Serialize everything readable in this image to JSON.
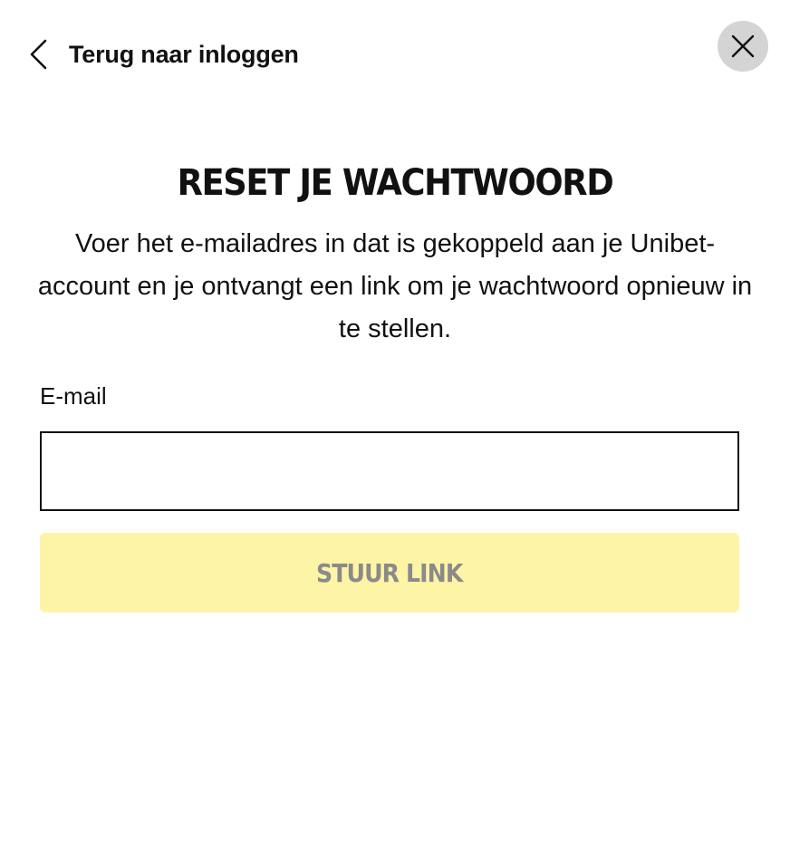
{
  "header": {
    "back_label": "Terug naar inloggen",
    "back_icon": "chevron-left-icon",
    "close_icon": "close-icon"
  },
  "main": {
    "title": "RESET JE WACHTWOORD",
    "description": "Voer het e-mailadres in dat is gekoppeld aan je Unibet-account en je ontvangt een link om je wachtwoord opnieuw in te stellen.",
    "email_label": "E-mail",
    "email_value": "",
    "submit_label": "STUUR LINK"
  },
  "colors": {
    "button_bg": "#fdf4a6",
    "button_text": "#8a8a8a",
    "close_bg": "#d4d4d4",
    "text": "#111111"
  }
}
